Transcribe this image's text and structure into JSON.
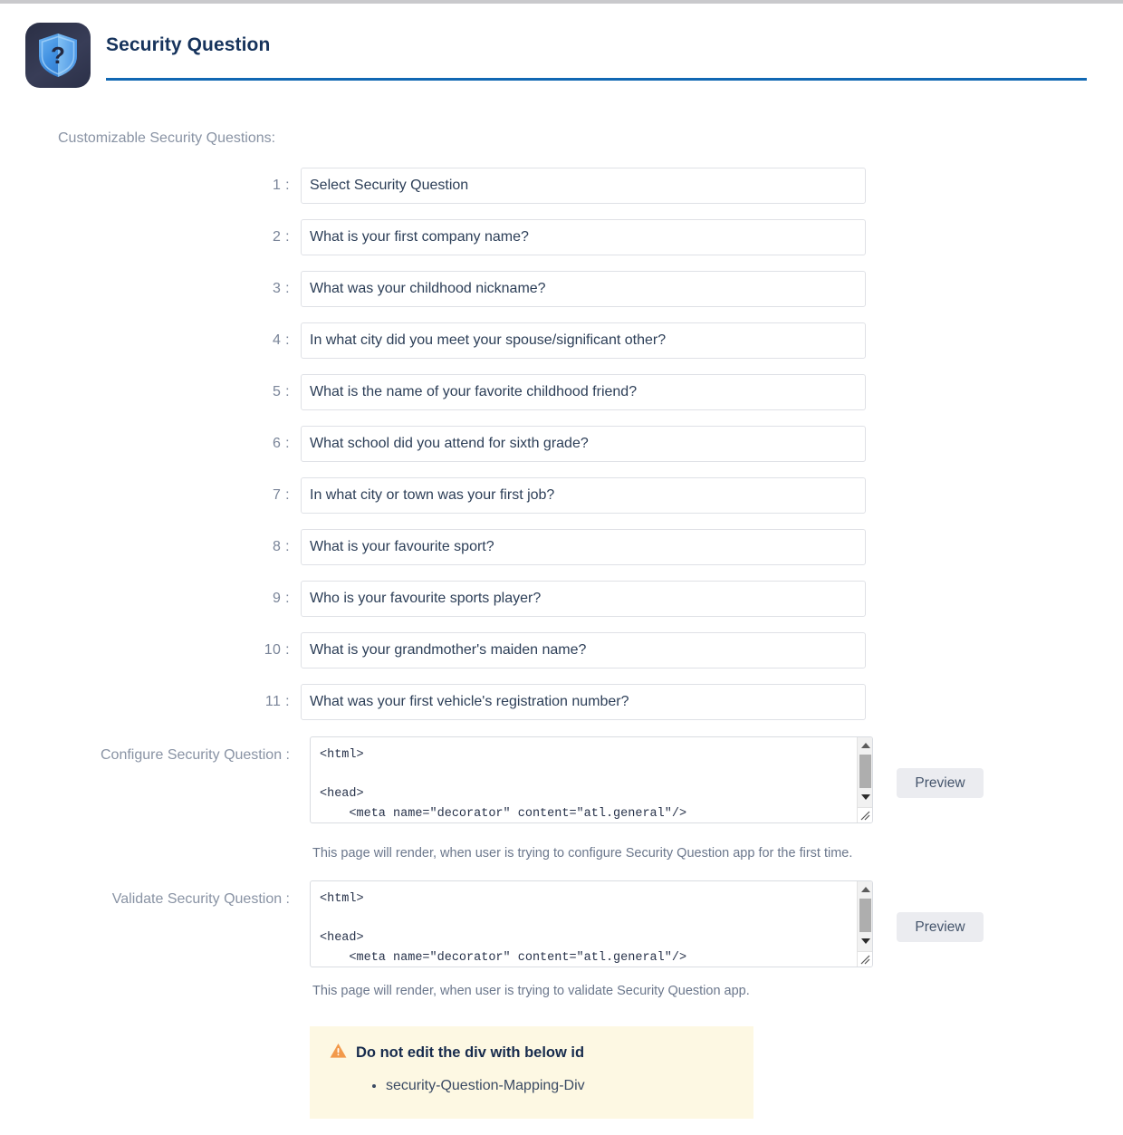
{
  "header": {
    "title": "Security Question",
    "icon": "shield-question-icon",
    "rule_color": "#1168b3",
    "icon_bg": "#2e3350",
    "title_color": "#16335c"
  },
  "section": {
    "label": "Customizable Security Questions:"
  },
  "questions": [
    {
      "num": "1 :",
      "value": "Select Security Question"
    },
    {
      "num": "2 :",
      "value": "What is your first company name?"
    },
    {
      "num": "3 :",
      "value": "What was your childhood nickname?"
    },
    {
      "num": "4 :",
      "value": "In what city did you meet your spouse/significant other?"
    },
    {
      "num": "5 :",
      "value": "What is the name of your favorite childhood friend?"
    },
    {
      "num": "6 :",
      "value": "What school did you attend for sixth grade?"
    },
    {
      "num": "7 :",
      "value": "In what city or town was your first job?"
    },
    {
      "num": "8 :",
      "value": "What is your favourite sport?"
    },
    {
      "num": "9 :",
      "value": "Who is your favourite sports player?"
    },
    {
      "num": "10 :",
      "value": "What is your grandmother's maiden name?"
    },
    {
      "num": "11 :",
      "value": "What was your first vehicle's registration number?"
    }
  ],
  "configure": {
    "label": "Configure Security Question :",
    "code": "<html>\n\n<head>\n    <meta name=\"decorator\" content=\"atl.general\"/>",
    "help": "This page will render, when user is trying to configure Security Question app for the first time.",
    "preview_label": "Preview"
  },
  "validate": {
    "label": "Validate Security Question :",
    "code": "<html>\n\n<head>\n    <meta name=\"decorator\" content=\"atl.general\"/>",
    "help": "This page will render, when user is trying to validate Security Question app.",
    "preview_label": "Preview"
  },
  "note": {
    "icon": "warning-triangle-icon",
    "title": "Do not edit the div with below id",
    "items": [
      "security-Question-Mapping-Div"
    ],
    "bg_color": "#fdf8e3",
    "icon_color": "#f2994a"
  }
}
